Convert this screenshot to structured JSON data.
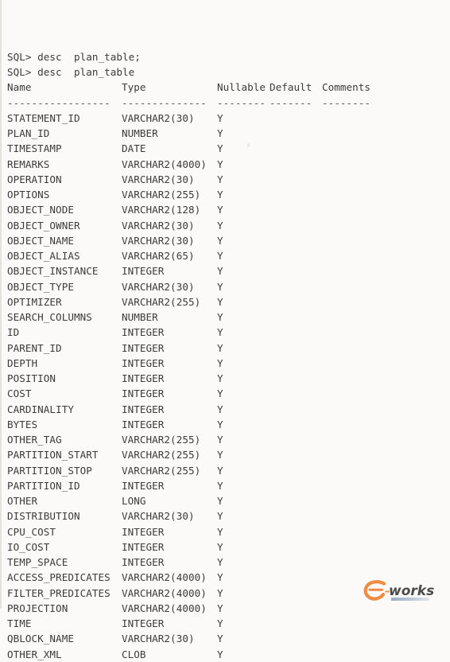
{
  "terminal": {
    "prompt_lines": [
      "SQL> desc  plan_table;",
      "SQL> desc  plan_table"
    ],
    "header": {
      "name": "Name",
      "type": "Type",
      "nullable": "Nullable",
      "default": "Default",
      "comments": "Comments"
    },
    "separator": {
      "name": "-----------------",
      "type": "--------------",
      "nullable": "--------",
      "default": "-------",
      "comments": "--------"
    },
    "rows": [
      {
        "name": "STATEMENT_ID",
        "type": "VARCHAR2(30)",
        "nullable": "Y",
        "default": "",
        "comments": ""
      },
      {
        "name": "PLAN_ID",
        "type": "NUMBER",
        "nullable": "Y",
        "default": "",
        "comments": ""
      },
      {
        "name": "TIMESTAMP",
        "type": "DATE",
        "nullable": "Y",
        "default": "",
        "comments": ""
      },
      {
        "name": "REMARKS",
        "type": "VARCHAR2(4000)",
        "nullable": "Y",
        "default": "",
        "comments": ""
      },
      {
        "name": "OPERATION",
        "type": "VARCHAR2(30)",
        "nullable": "Y",
        "default": "",
        "comments": ""
      },
      {
        "name": "OPTIONS",
        "type": "VARCHAR2(255)",
        "nullable": "Y",
        "default": "",
        "comments": ""
      },
      {
        "name": "OBJECT_NODE",
        "type": "VARCHAR2(128)",
        "nullable": "Y",
        "default": "",
        "comments": ""
      },
      {
        "name": "OBJECT_OWNER",
        "type": "VARCHAR2(30)",
        "nullable": "Y",
        "default": "",
        "comments": ""
      },
      {
        "name": "OBJECT_NAME",
        "type": "VARCHAR2(30)",
        "nullable": "Y",
        "default": "",
        "comments": ""
      },
      {
        "name": "OBJECT_ALIAS",
        "type": "VARCHAR2(65)",
        "nullable": "Y",
        "default": "",
        "comments": ""
      },
      {
        "name": "OBJECT_INSTANCE",
        "type": "INTEGER",
        "nullable": "Y",
        "default": "",
        "comments": ""
      },
      {
        "name": "OBJECT_TYPE",
        "type": "VARCHAR2(30)",
        "nullable": "Y",
        "default": "",
        "comments": ""
      },
      {
        "name": "OPTIMIZER",
        "type": "VARCHAR2(255)",
        "nullable": "Y",
        "default": "",
        "comments": ""
      },
      {
        "name": "SEARCH_COLUMNS",
        "type": "NUMBER",
        "nullable": "Y",
        "default": "",
        "comments": ""
      },
      {
        "name": "ID",
        "type": "INTEGER",
        "nullable": "Y",
        "default": "",
        "comments": ""
      },
      {
        "name": "PARENT_ID",
        "type": "INTEGER",
        "nullable": "Y",
        "default": "",
        "comments": ""
      },
      {
        "name": "DEPTH",
        "type": "INTEGER",
        "nullable": "Y",
        "default": "",
        "comments": ""
      },
      {
        "name": "POSITION",
        "type": "INTEGER",
        "nullable": "Y",
        "default": "",
        "comments": ""
      },
      {
        "name": "COST",
        "type": "INTEGER",
        "nullable": "Y",
        "default": "",
        "comments": ""
      },
      {
        "name": "CARDINALITY",
        "type": "INTEGER",
        "nullable": "Y",
        "default": "",
        "comments": ""
      },
      {
        "name": "BYTES",
        "type": "INTEGER",
        "nullable": "Y",
        "default": "",
        "comments": ""
      },
      {
        "name": "OTHER_TAG",
        "type": "VARCHAR2(255)",
        "nullable": "Y",
        "default": "",
        "comments": ""
      },
      {
        "name": "PARTITION_START",
        "type": "VARCHAR2(255)",
        "nullable": "Y",
        "default": "",
        "comments": ""
      },
      {
        "name": "PARTITION_STOP",
        "type": "VARCHAR2(255)",
        "nullable": "Y",
        "default": "",
        "comments": ""
      },
      {
        "name": "PARTITION_ID",
        "type": "INTEGER",
        "nullable": "Y",
        "default": "",
        "comments": ""
      },
      {
        "name": "OTHER",
        "type": "LONG",
        "nullable": "Y",
        "default": "",
        "comments": ""
      },
      {
        "name": "DISTRIBUTION",
        "type": "VARCHAR2(30)",
        "nullable": "Y",
        "default": "",
        "comments": ""
      },
      {
        "name": "CPU_COST",
        "type": "INTEGER",
        "nullable": "Y",
        "default": "",
        "comments": ""
      },
      {
        "name": "IO_COST",
        "type": "INTEGER",
        "nullable": "Y",
        "default": "",
        "comments": ""
      },
      {
        "name": "TEMP_SPACE",
        "type": "INTEGER",
        "nullable": "Y",
        "default": "",
        "comments": ""
      },
      {
        "name": "ACCESS_PREDICATES",
        "type": "VARCHAR2(4000)",
        "nullable": "Y",
        "default": "",
        "comments": ""
      },
      {
        "name": "FILTER_PREDICATES",
        "type": "VARCHAR2(4000)",
        "nullable": "Y",
        "default": "",
        "comments": ""
      },
      {
        "name": "PROJECTION",
        "type": "VARCHAR2(4000)",
        "nullable": "Y",
        "default": "",
        "comments": ""
      },
      {
        "name": "TIME",
        "type": "INTEGER",
        "nullable": "Y",
        "default": "",
        "comments": ""
      },
      {
        "name": "QBLOCK_NAME",
        "type": "VARCHAR2(30)",
        "nullable": "Y",
        "default": "",
        "comments": ""
      },
      {
        "name": "OTHER_XML",
        "type": "CLOB",
        "nullable": "Y",
        "default": "",
        "comments": ""
      }
    ]
  },
  "watermark": {
    "e_letter": "e",
    "dash": "-",
    "word": "works",
    "colors": {
      "e": "#ef8233",
      "word": "#3c3c3c",
      "bar_left": "#8fa8c4",
      "bar_right": "#d8dde3"
    }
  },
  "theme": {
    "background": "#fbfaf8",
    "text": "#3b3b3b",
    "rule": "#5a5a5a",
    "edge": "#e6e4df"
  }
}
